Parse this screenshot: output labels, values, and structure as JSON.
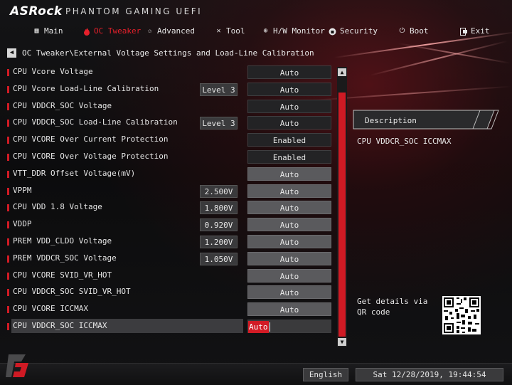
{
  "header": {
    "logo": "ASRock",
    "subtitle": "PHANTOM GAMING UEFI"
  },
  "menu": [
    {
      "label": "Main",
      "icon": "grid-icon",
      "active": false
    },
    {
      "label": "OC Tweaker",
      "icon": "flame-icon",
      "active": true
    },
    {
      "label": "Advanced",
      "icon": "star-icon",
      "active": false
    },
    {
      "label": "Tool",
      "icon": "tools-icon",
      "active": false
    },
    {
      "label": "H/W Monitor",
      "icon": "monitor-icon",
      "active": false
    },
    {
      "label": "Security",
      "icon": "shield-icon",
      "active": false
    },
    {
      "label": "Boot",
      "icon": "power-icon",
      "active": false
    },
    {
      "label": "Exit",
      "icon": "exit-icon",
      "active": false
    }
  ],
  "breadcrumb": "OC Tweaker\\External Voltage Settings and Load-Line Calibration",
  "settings": [
    {
      "label": "CPU Vcore Voltage",
      "sub": "",
      "value": "Auto",
      "style": "dark"
    },
    {
      "label": "CPU Vcore Load-Line Calibration",
      "sub": "Level 3",
      "value": "Auto",
      "style": "dark"
    },
    {
      "label": "CPU VDDCR_SOC Voltage",
      "sub": "",
      "value": "Auto",
      "style": "dark"
    },
    {
      "label": "CPU VDDCR_SOC Load-Line Calibration",
      "sub": "Level 3",
      "value": "Auto",
      "style": "dark"
    },
    {
      "label": "CPU VCORE Over Current Protection",
      "sub": "",
      "value": "Enabled",
      "style": "dark"
    },
    {
      "label": "CPU VCORE Over Voltage Protection",
      "sub": "",
      "value": "Enabled",
      "style": "dark"
    },
    {
      "label": "VTT_DDR Offset Voltage(mV)",
      "sub": "",
      "value": "Auto",
      "style": "grey"
    },
    {
      "label": "VPPM",
      "sub": "2.500V",
      "value": "Auto",
      "style": "grey"
    },
    {
      "label": "CPU VDD 1.8 Voltage",
      "sub": "1.800V",
      "value": "Auto",
      "style": "grey"
    },
    {
      "label": "VDDP",
      "sub": "0.920V",
      "value": "Auto",
      "style": "grey"
    },
    {
      "label": "PREM VDD_CLDO Voltage",
      "sub": "1.200V",
      "value": "Auto",
      "style": "grey"
    },
    {
      "label": "PREM VDDCR_SOC Voltage",
      "sub": "1.050V",
      "value": "Auto",
      "style": "grey"
    },
    {
      "label": "CPU VCORE SVID_VR_HOT",
      "sub": "",
      "value": "Auto",
      "style": "grey"
    },
    {
      "label": "CPU VDDCR_SOC SVID_VR_HOT",
      "sub": "",
      "value": "Auto",
      "style": "grey"
    },
    {
      "label": "CPU VCORE ICCMAX",
      "sub": "",
      "value": "Auto",
      "style": "grey"
    },
    {
      "label": "CPU VDDCR_SOC ICCMAX",
      "sub": "",
      "value": "Auto",
      "style": "editing",
      "selected": true
    }
  ],
  "description": {
    "title": "Description",
    "text": "CPU VDDCR_SOC ICCMAX"
  },
  "qr_text": "Get details via QR code",
  "footer": {
    "language": "English",
    "datetime": "Sat 12/28/2019, 19:44:54"
  },
  "colors": {
    "accent": "#d21b25",
    "background": "#0b0b0c",
    "field_dark": "#232325",
    "field_grey": "#5a5a5d"
  }
}
